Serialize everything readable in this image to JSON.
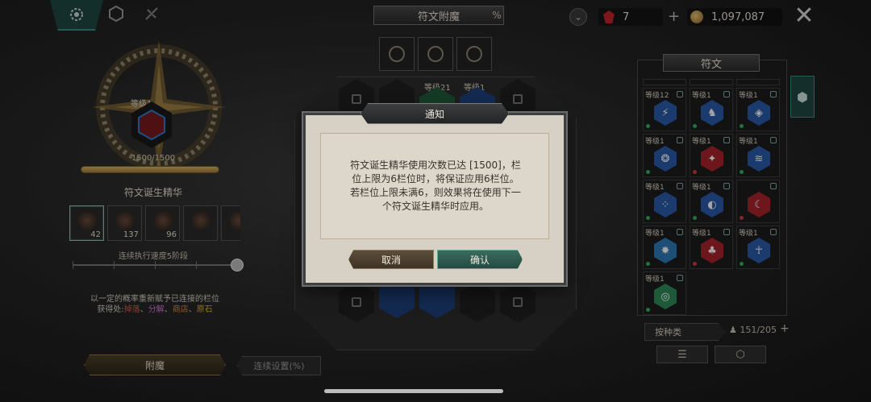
{
  "top_tabs": [
    {
      "icon": "rune-gear-icon",
      "active": true
    },
    {
      "icon": "hex-gem-icon",
      "active": false
    },
    {
      "icon": "crossed-swords-icon",
      "active": false
    }
  ],
  "header": {
    "title": "符文附魔",
    "title_suffix": "%",
    "gems": "7",
    "gold": "1,097,087",
    "plus": "+",
    "close": "✕"
  },
  "left_panel": {
    "level_label": "等级1",
    "progress_text": "1500/1500",
    "progress_value": 1500,
    "progress_max": 1500,
    "essence_label": "符文诞生精华",
    "items": [
      {
        "count": "42",
        "selected": true
      },
      {
        "count": "137",
        "selected": false
      },
      {
        "count": "96",
        "selected": false
      },
      {
        "count": "",
        "selected": false
      },
      {
        "count": "",
        "selected": false
      }
    ],
    "speed_label": "连续执行速度5阶段",
    "slider_value": 5,
    "slider_max": 5,
    "info_line1": "以一定的概率重新赋予已连接的栏位",
    "info_line2_prefix": "获得处:",
    "sources": [
      {
        "text": "掉落",
        "color": "#e05a4a"
      },
      {
        "text": "、",
        "color": "#d8d0c0"
      },
      {
        "text": "分解",
        "color": "#d57bdc"
      },
      {
        "text": "、",
        "color": "#d8d0c0"
      },
      {
        "text": "商店",
        "color": "#dd8a3a"
      },
      {
        "text": "、",
        "color": "#d8d0c0"
      },
      {
        "text": "原石",
        "color": "#d6b23a"
      }
    ],
    "enchant_button": "附魔",
    "continuous_button": "连续设置(%)"
  },
  "board": {
    "slot_level_a": "等级21",
    "slot_level_b": "等级1"
  },
  "dialog": {
    "title": "通知",
    "lines": [
      "符文诞生精华使用次数已达 [1500]，栏",
      "位上限为6栏位时，将保证应用6栏位。",
      "若栏位上限未满6，则效果将在使用下一",
      "个符文诞生精华时应用。"
    ],
    "cancel": "取消",
    "confirm": "确认"
  },
  "right_panel": {
    "title": "符文",
    "runes": [
      {
        "level": "等级12",
        "dot": "#2fb35a",
        "color": "#2a5aa8",
        "glyph": "⚡"
      },
      {
        "level": "等级1",
        "dot": "#2fb35a",
        "color": "#2a5aa8",
        "glyph": "♞"
      },
      {
        "level": "等级1",
        "dot": "#2fb35a",
        "color": "#2a5aa8",
        "glyph": "◈"
      },
      {
        "level": "等级1",
        "dot": "#2fb35a",
        "color": "#2a5aa8",
        "glyph": "❂"
      },
      {
        "level": "等级1",
        "dot": "#d23a3a",
        "color": "#a8232b",
        "glyph": "✦"
      },
      {
        "level": "等级1",
        "dot": "#2fb35a",
        "color": "#2a5aa8",
        "glyph": "≋"
      },
      {
        "level": "等级1",
        "dot": "#2fb35a",
        "color": "#2a5aa8",
        "glyph": "⁘"
      },
      {
        "level": "等级1",
        "dot": "#2fb35a",
        "color": "#2a5aa8",
        "glyph": "◐"
      },
      {
        "level": "",
        "dot": "#d23a3a",
        "color": "#a8232b",
        "glyph": "☾"
      },
      {
        "level": "等级1",
        "dot": "#2fb35a",
        "color": "#2f7ab8",
        "glyph": "✸"
      },
      {
        "level": "等级1",
        "dot": "#d23a3a",
        "color": "#a8232b",
        "glyph": "♣"
      },
      {
        "level": "等级1",
        "dot": "#2fb35a",
        "color": "#2a5aa8",
        "glyph": "☥"
      },
      {
        "level": "等级1",
        "dot": "#2fb35a",
        "color": "#2f8a58",
        "glyph": "◎"
      }
    ],
    "sort_button": "按种类",
    "count": "151/205",
    "count_plus": "+",
    "list_icon": "☰",
    "cube_icon": "⬡"
  }
}
